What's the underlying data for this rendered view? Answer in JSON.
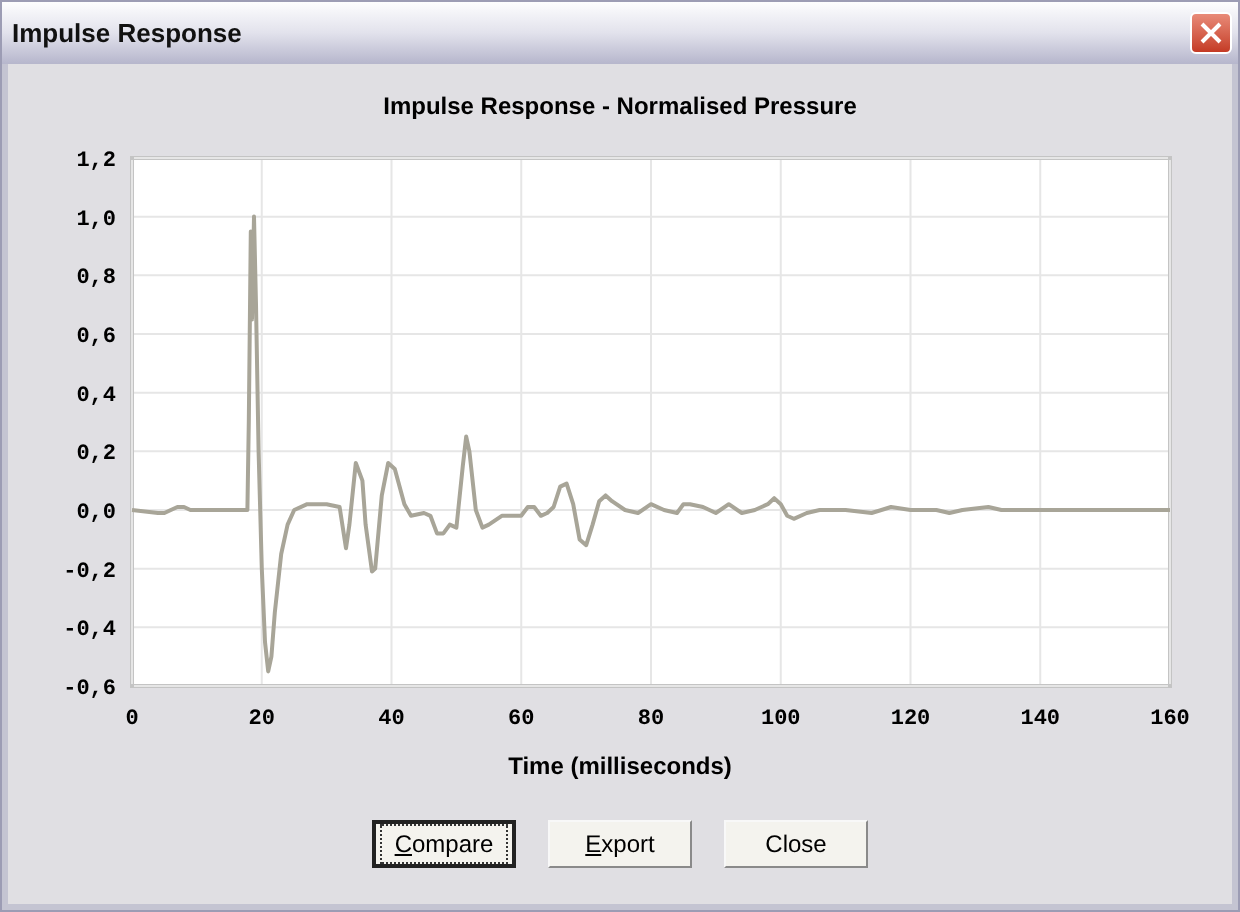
{
  "window": {
    "title": "Impulse Response"
  },
  "chart": {
    "chart_data": {
      "type": "line",
      "title": "Impulse Response - Normalised Pressure",
      "xlabel": "Time (milliseconds)",
      "grid": true,
      "xlim": [
        0,
        160
      ],
      "ylim": [
        -0.6,
        1.2
      ],
      "xticks": [
        {
          "value": 0,
          "label": "0"
        },
        {
          "value": 20,
          "label": "20"
        },
        {
          "value": 40,
          "label": "40"
        },
        {
          "value": 60,
          "label": "60"
        },
        {
          "value": 80,
          "label": "80"
        },
        {
          "value": 100,
          "label": "100"
        },
        {
          "value": 120,
          "label": "120"
        },
        {
          "value": 140,
          "label": "140"
        },
        {
          "value": 160,
          "label": "160"
        }
      ],
      "yticks": [
        {
          "value": 1.2,
          "label": "1,2"
        },
        {
          "value": 1.0,
          "label": "1,0"
        },
        {
          "value": 0.8,
          "label": "0,8"
        },
        {
          "value": 0.6,
          "label": "0,6"
        },
        {
          "value": 0.4,
          "label": "0,4"
        },
        {
          "value": 0.2,
          "label": "0,2"
        },
        {
          "value": 0,
          "label": "0,0"
        },
        {
          "value": -0.2,
          "label": "-0,2"
        },
        {
          "value": -0.4,
          "label": "-0,4"
        },
        {
          "value": -0.6,
          "label": "-0,6"
        }
      ],
      "x": [
        0,
        4,
        5,
        7,
        8,
        9,
        17.8,
        18,
        18.3,
        18.5,
        18.8,
        19.1,
        19.5,
        20,
        20.5,
        21,
        21.5,
        22,
        23,
        24,
        25,
        27,
        30,
        32,
        33,
        33.5,
        34.5,
        35.5,
        36,
        37,
        37.5,
        38.5,
        39.5,
        40.5,
        42,
        43,
        45,
        46,
        47,
        48,
        49,
        50,
        51,
        51.5,
        52,
        53,
        54,
        55,
        57,
        60,
        61,
        62,
        63,
        64,
        65,
        66,
        67,
        68,
        69,
        70,
        71,
        72,
        73,
        74,
        76,
        78,
        80,
        82,
        84,
        85,
        86,
        88,
        90,
        92,
        94,
        96,
        98,
        99,
        100,
        101,
        102,
        104,
        106,
        110,
        114,
        117,
        120,
        124,
        126,
        128,
        132,
        134,
        160
      ],
      "series": [
        {
          "color": "#a8a598",
          "values": [
            0,
            -0.01,
            -0.01,
            0.01,
            0.01,
            0,
            0,
            0.3,
            0.95,
            0.65,
            1.0,
            0.7,
            0.2,
            -0.2,
            -0.45,
            -0.55,
            -0.5,
            -0.35,
            -0.15,
            -0.05,
            0,
            0.02,
            0.02,
            0.01,
            -0.13,
            -0.05,
            0.16,
            0.1,
            -0.05,
            -0.21,
            -0.2,
            0.05,
            0.16,
            0.14,
            0.02,
            -0.02,
            -0.01,
            -0.02,
            -0.08,
            -0.08,
            -0.05,
            -0.06,
            0.15,
            0.25,
            0.2,
            0,
            -0.06,
            -0.05,
            -0.02,
            -0.02,
            0.01,
            0.01,
            -0.02,
            -0.01,
            0.01,
            0.08,
            0.09,
            0.02,
            -0.1,
            -0.12,
            -0.05,
            0.03,
            0.05,
            0.03,
            0,
            -0.01,
            0.02,
            0,
            -0.01,
            0.02,
            0.02,
            0.01,
            -0.01,
            0.02,
            -0.01,
            0,
            0.02,
            0.04,
            0.02,
            -0.02,
            -0.03,
            -0.01,
            0,
            0,
            -0.01,
            0.01,
            0,
            0,
            -0.01,
            0,
            0.01,
            0,
            0
          ]
        }
      ]
    }
  },
  "buttons": [
    {
      "label": "Compare",
      "mnemonic": true,
      "focused": true
    },
    {
      "label": "Export",
      "mnemonic": true,
      "focused": false
    },
    {
      "label": "Close",
      "mnemonic": false,
      "focused": false
    }
  ]
}
